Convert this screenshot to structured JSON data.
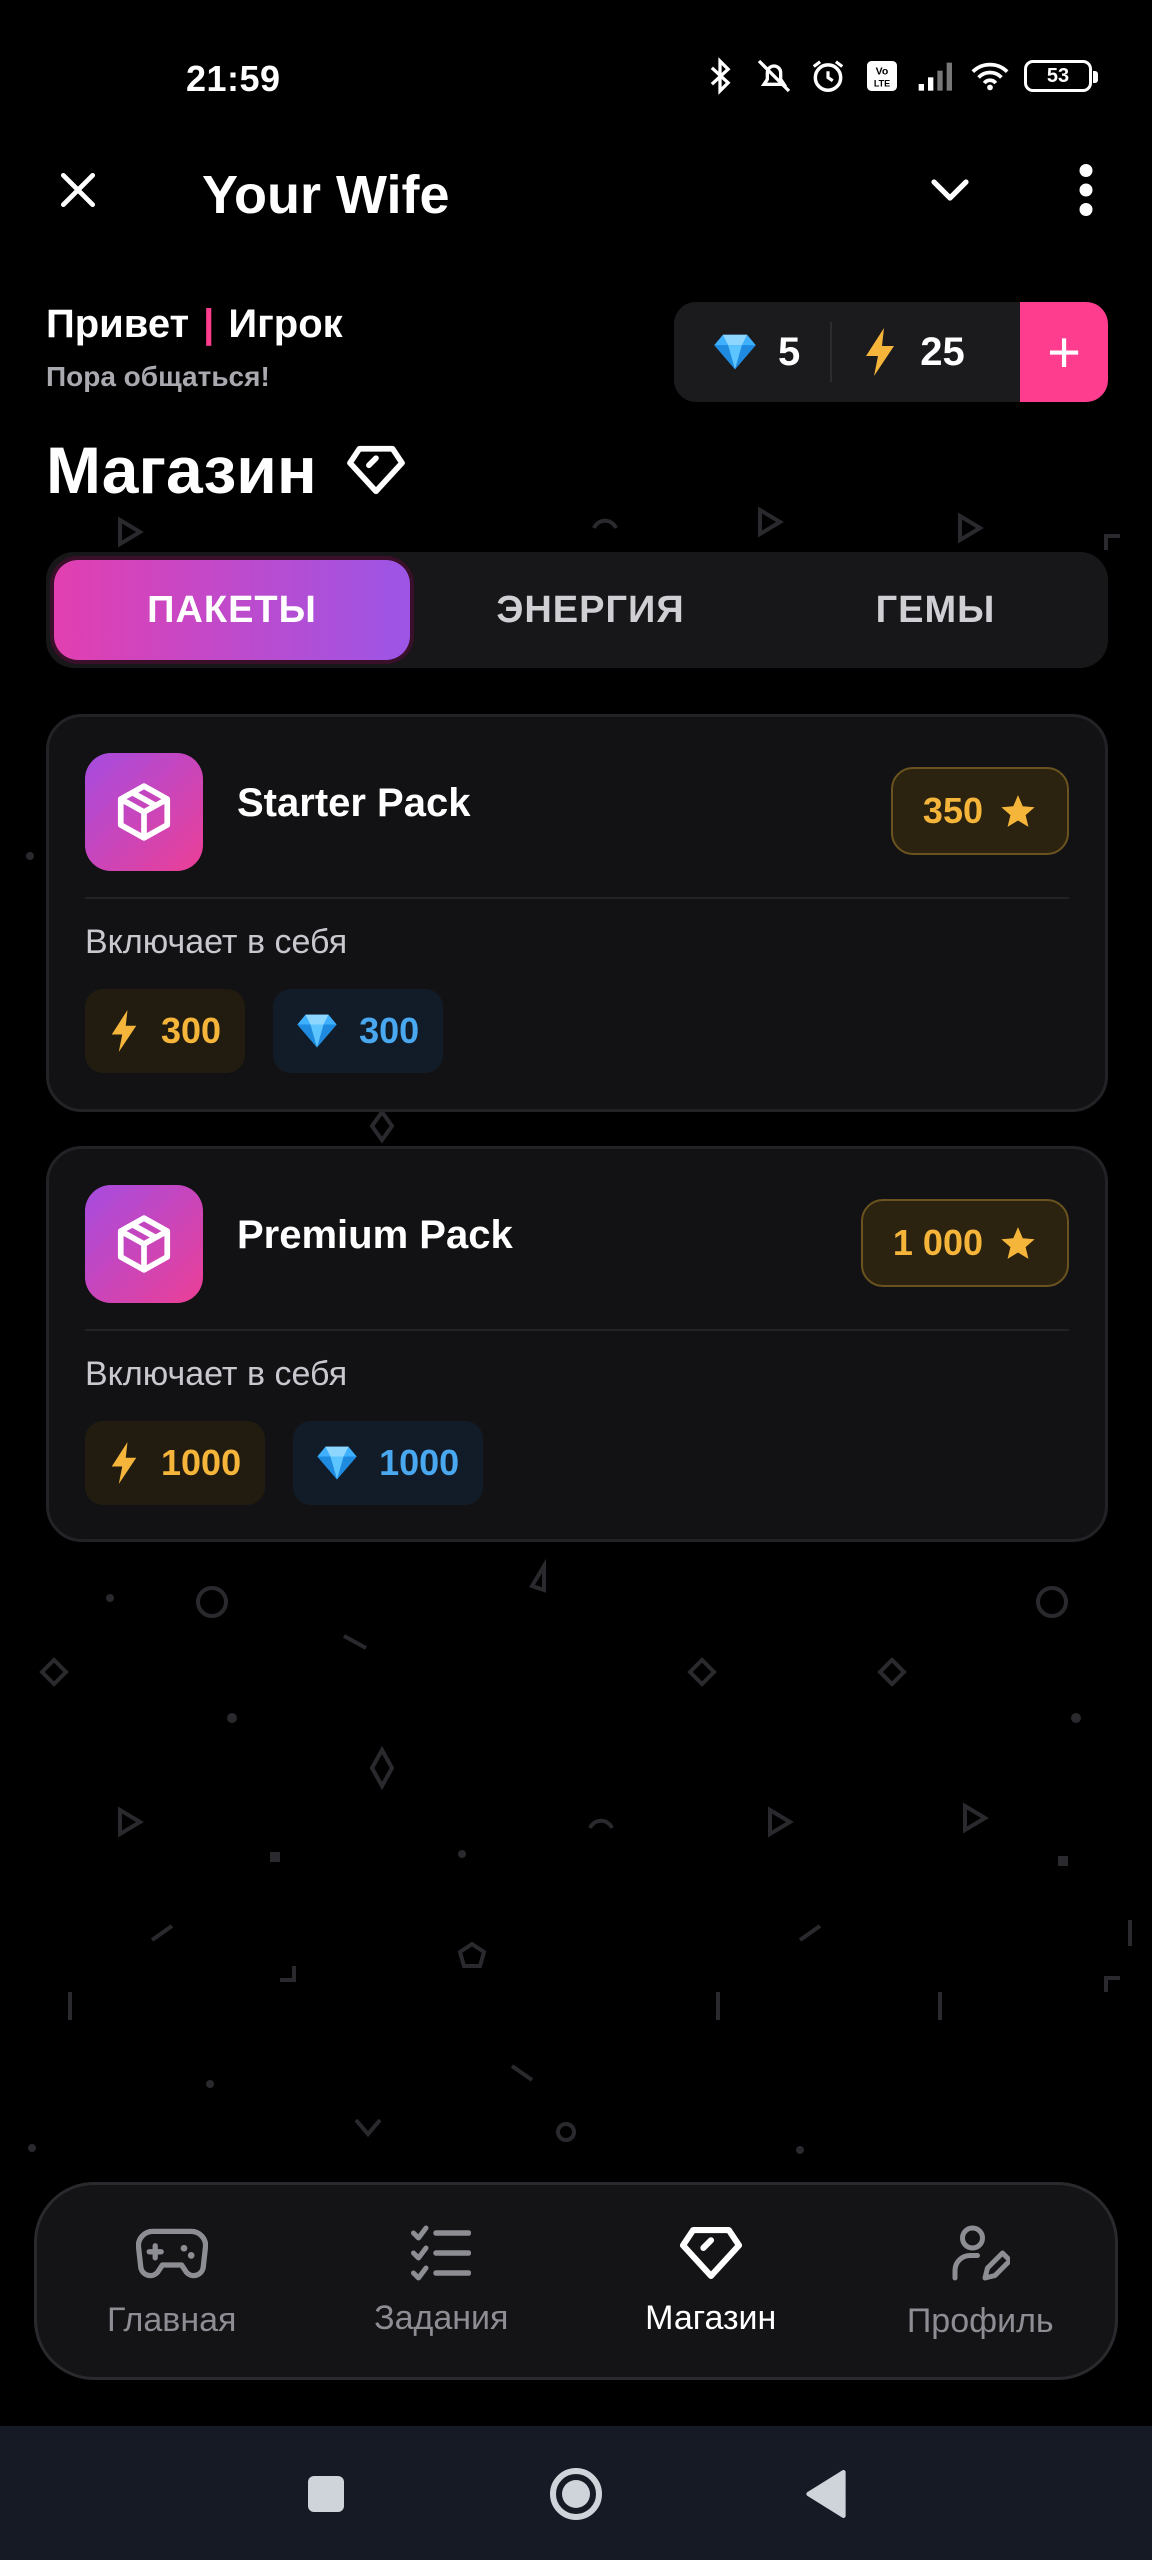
{
  "status_bar": {
    "time": "21:59",
    "battery": "53",
    "icons": [
      "bluetooth-icon",
      "mute-icon",
      "alarm-icon",
      "volte-icon",
      "signal-icon",
      "wifi-icon",
      "battery-icon"
    ]
  },
  "header": {
    "title": "Your Wife",
    "icons": [
      "close-icon",
      "chevron-down-icon",
      "more-vertical-icon"
    ]
  },
  "greeting": {
    "hello": "Привет",
    "separator": "|",
    "name": "Игрок",
    "subtitle": "Пора общаться!"
  },
  "balance": {
    "gems": "5",
    "energy": "25",
    "add_label": "+"
  },
  "page": {
    "title": "Магазин"
  },
  "tabs": [
    {
      "label": "ПАКЕТЫ",
      "active": true
    },
    {
      "label": "ЭНЕРГИЯ",
      "active": false
    },
    {
      "label": "ГЕМЫ",
      "active": false
    }
  ],
  "packs": [
    {
      "name": "Starter Pack",
      "price": "350",
      "includes_label": "Включает в себя",
      "energy": "300",
      "gems": "300"
    },
    {
      "name": "Premium Pack",
      "price": "1 000",
      "includes_label": "Включает в себя",
      "energy": "1000",
      "gems": "1000"
    }
  ],
  "bottom_nav": [
    {
      "label": "Главная",
      "icon": "gamepad-icon",
      "active": false
    },
    {
      "label": "Задания",
      "icon": "checklist-icon",
      "active": false
    },
    {
      "label": "Магазин",
      "icon": "diamond-icon",
      "active": true
    },
    {
      "label": "Профиль",
      "icon": "profile-edit-icon",
      "active": false
    }
  ],
  "colors": {
    "accent_pink": "#ff3d8e",
    "gradient_start": "#e23fb0",
    "gradient_end": "#9c55e6",
    "gold": "#f5b43a",
    "gem_blue": "#4aa8f0"
  }
}
